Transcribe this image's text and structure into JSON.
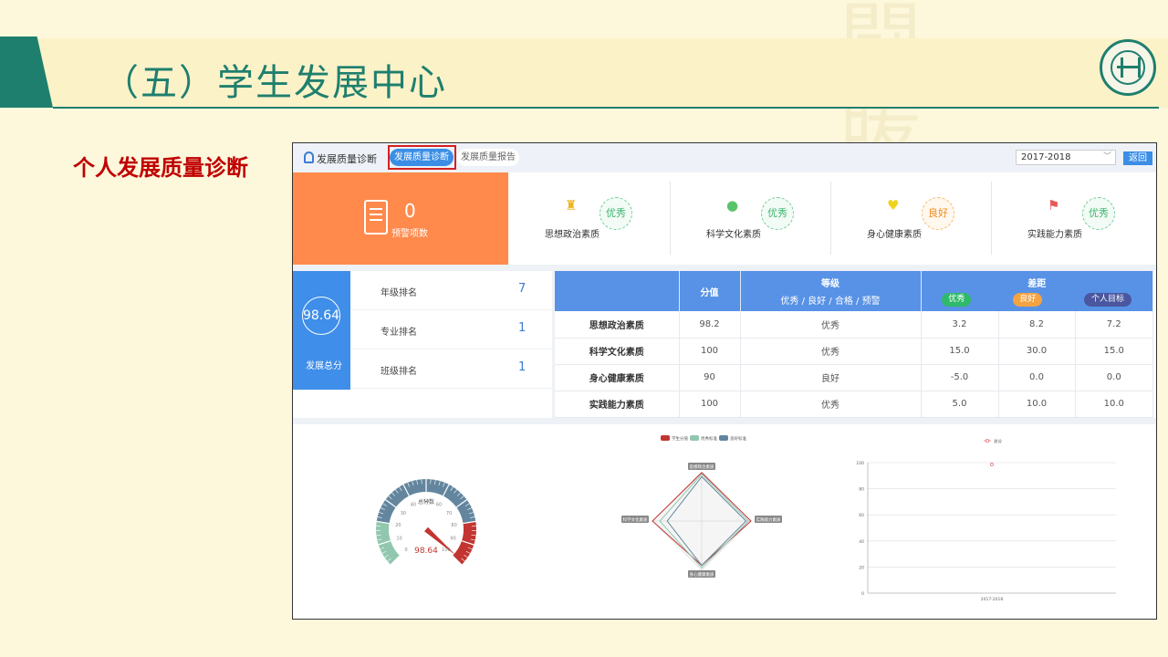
{
  "slide": {
    "title": "（五）学生发展中心",
    "subtitle": "个人发展质量诊断"
  },
  "app": {
    "header_title": "发展质量诊断",
    "tab_active": "发展质量诊断",
    "tab_other": "发展质量报告",
    "year": "2017-2018",
    "back_label": "返回"
  },
  "summary": {
    "warning_count": "0",
    "warning_label": "预警项数",
    "categories": [
      {
        "label": "思想政治素质",
        "grade": "优秀",
        "icon": "reading-person-icon"
      },
      {
        "label": "科学文化素质",
        "grade": "优秀",
        "icon": "globe-icon"
      },
      {
        "label": "身心健康素质",
        "grade": "良好",
        "icon": "heart-icon"
      },
      {
        "label": "实践能力素质",
        "grade": "优秀",
        "icon": "flag-icon"
      }
    ]
  },
  "score": {
    "total": "98.64",
    "label": "发展总分"
  },
  "ranks": [
    {
      "name": "年级排名",
      "value": "7"
    },
    {
      "name": "专业排名",
      "value": "1"
    },
    {
      "name": "班级排名",
      "value": "1"
    }
  ],
  "grade_table": {
    "col_score": "分值",
    "col_level": "等级",
    "col_level_sub": "优秀 / 良好 / 合格 / 预警",
    "col_gap": "差距",
    "gap_excellent": "优秀",
    "gap_good": "良好",
    "gap_target": "个人目标",
    "rows": [
      {
        "name": "思想政治素质",
        "score": "98.2",
        "level": "优秀",
        "g1": "3.2",
        "g2": "8.2",
        "g3": "7.2"
      },
      {
        "name": "科学文化素质",
        "score": "100",
        "level": "优秀",
        "g1": "15.0",
        "g2": "30.0",
        "g3": "15.0"
      },
      {
        "name": "身心健康素质",
        "score": "90",
        "level": "良好",
        "g1": "-5.0",
        "g2": "0.0",
        "g3": "0.0"
      },
      {
        "name": "实践能力素质",
        "score": "100",
        "level": "优秀",
        "g1": "5.0",
        "g2": "10.0",
        "g3": "10.0"
      }
    ]
  },
  "chart_data": [
    {
      "type": "gauge",
      "title": "总分数",
      "value": 98.64,
      "value_label": "98.64",
      "range": [
        0,
        100
      ],
      "ticks": [
        "0",
        "10",
        "20",
        "30",
        "40",
        "50",
        "60",
        "70",
        "80",
        "90",
        "100"
      ],
      "bands": [
        {
          "from": 0,
          "to": 20,
          "color": "#91c7ae"
        },
        {
          "from": 20,
          "to": 80,
          "color": "#63869e"
        },
        {
          "from": 80,
          "to": 100,
          "color": "#c23531"
        }
      ]
    },
    {
      "type": "radar",
      "legend": [
        "学生分值",
        "优秀标准",
        "良好标准"
      ],
      "colors": [
        "#c23531",
        "#91c7ae",
        "#63869e"
      ],
      "axes": [
        "思想政治素质",
        "实践能力素质",
        "身心健康素质",
        "科学文化素质"
      ],
      "max": 100,
      "series": [
        {
          "name": "学生分值",
          "values": [
            98.2,
            100,
            90,
            100
          ]
        },
        {
          "name": "优秀标准",
          "values": [
            95,
            95,
            95,
            85
          ]
        },
        {
          "name": "良好标准",
          "values": [
            90,
            90,
            90,
            70
          ]
        }
      ]
    },
    {
      "type": "line",
      "legend": [
        "总分"
      ],
      "categories": [
        "2017-2018"
      ],
      "series": [
        {
          "name": "总分",
          "values": [
            98.64
          ]
        }
      ],
      "ylim": [
        0,
        100
      ],
      "yticks": [
        "0",
        "20",
        "40",
        "60",
        "80",
        "100"
      ],
      "color": "#e57373"
    }
  ]
}
